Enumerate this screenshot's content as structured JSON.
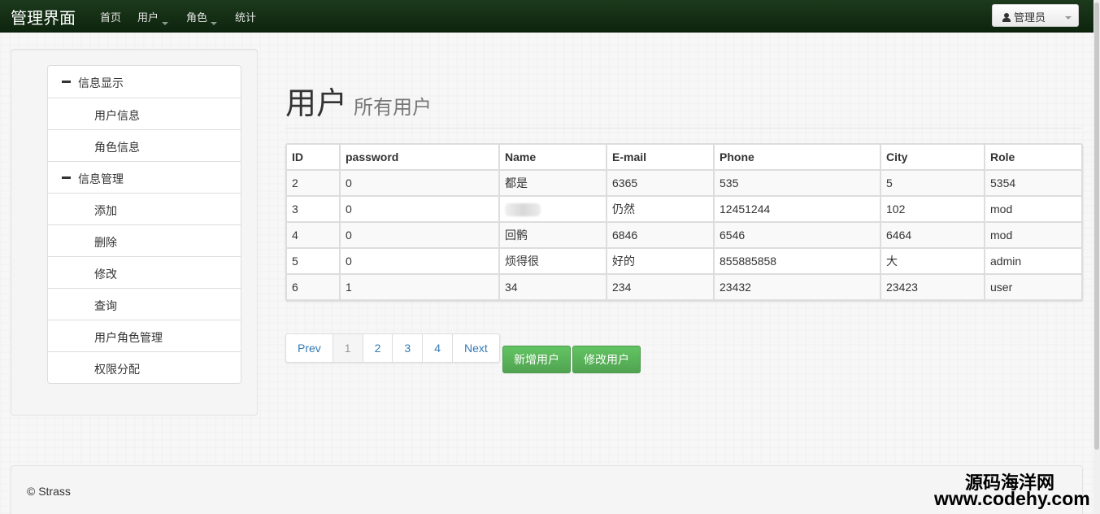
{
  "navbar": {
    "brand": "管理界面",
    "items": [
      {
        "label": "首页"
      },
      {
        "label": "用户"
      },
      {
        "label": "角色"
      },
      {
        "label": "统计"
      }
    ],
    "user_button": "管理员"
  },
  "sidebar": {
    "items": [
      {
        "label": "信息显示",
        "kind": "section"
      },
      {
        "label": "用户信息",
        "kind": "sub"
      },
      {
        "label": "角色信息",
        "kind": "sub"
      },
      {
        "label": "信息管理",
        "kind": "section"
      },
      {
        "label": "添加",
        "kind": "sub"
      },
      {
        "label": "删除",
        "kind": "sub"
      },
      {
        "label": "修改",
        "kind": "sub"
      },
      {
        "label": "查询",
        "kind": "sub"
      },
      {
        "label": "用户角色管理",
        "kind": "sub"
      },
      {
        "label": "权限分配",
        "kind": "sub"
      }
    ]
  },
  "header": {
    "title": "用户",
    "subtitle": "所有用户"
  },
  "table": {
    "columns": [
      "ID",
      "password",
      "Name",
      "E-mail",
      "Phone",
      "City",
      "Role"
    ],
    "rows": [
      [
        "2",
        "0",
        "都是",
        "6365",
        "535",
        "5",
        "5354"
      ],
      [
        "3",
        "0",
        "",
        "仍然",
        "12451244",
        "102",
        "mod"
      ],
      [
        "4",
        "0",
        "回鹘",
        "6846",
        "6546",
        "6464",
        "mod"
      ],
      [
        "5",
        "0",
        "烦得很",
        "好的",
        "855885858",
        "大",
        "admin"
      ],
      [
        "6",
        "1",
        "34",
        "234",
        "23432",
        "23423",
        "user"
      ]
    ]
  },
  "pagination": {
    "prev": "Prev",
    "pages": [
      "1",
      "2",
      "3",
      "4"
    ],
    "current": "1",
    "next": "Next"
  },
  "actions": {
    "add_user": "新增用户",
    "edit_user": "修改用户"
  },
  "footer": {
    "text": "© Strass"
  },
  "watermark": {
    "line1": "源码海洋网",
    "line2": "www.codehy.com"
  },
  "colors": {
    "navbar": "#0d240d",
    "button_green": "#5bb75b",
    "link_blue": "#337ab7"
  }
}
